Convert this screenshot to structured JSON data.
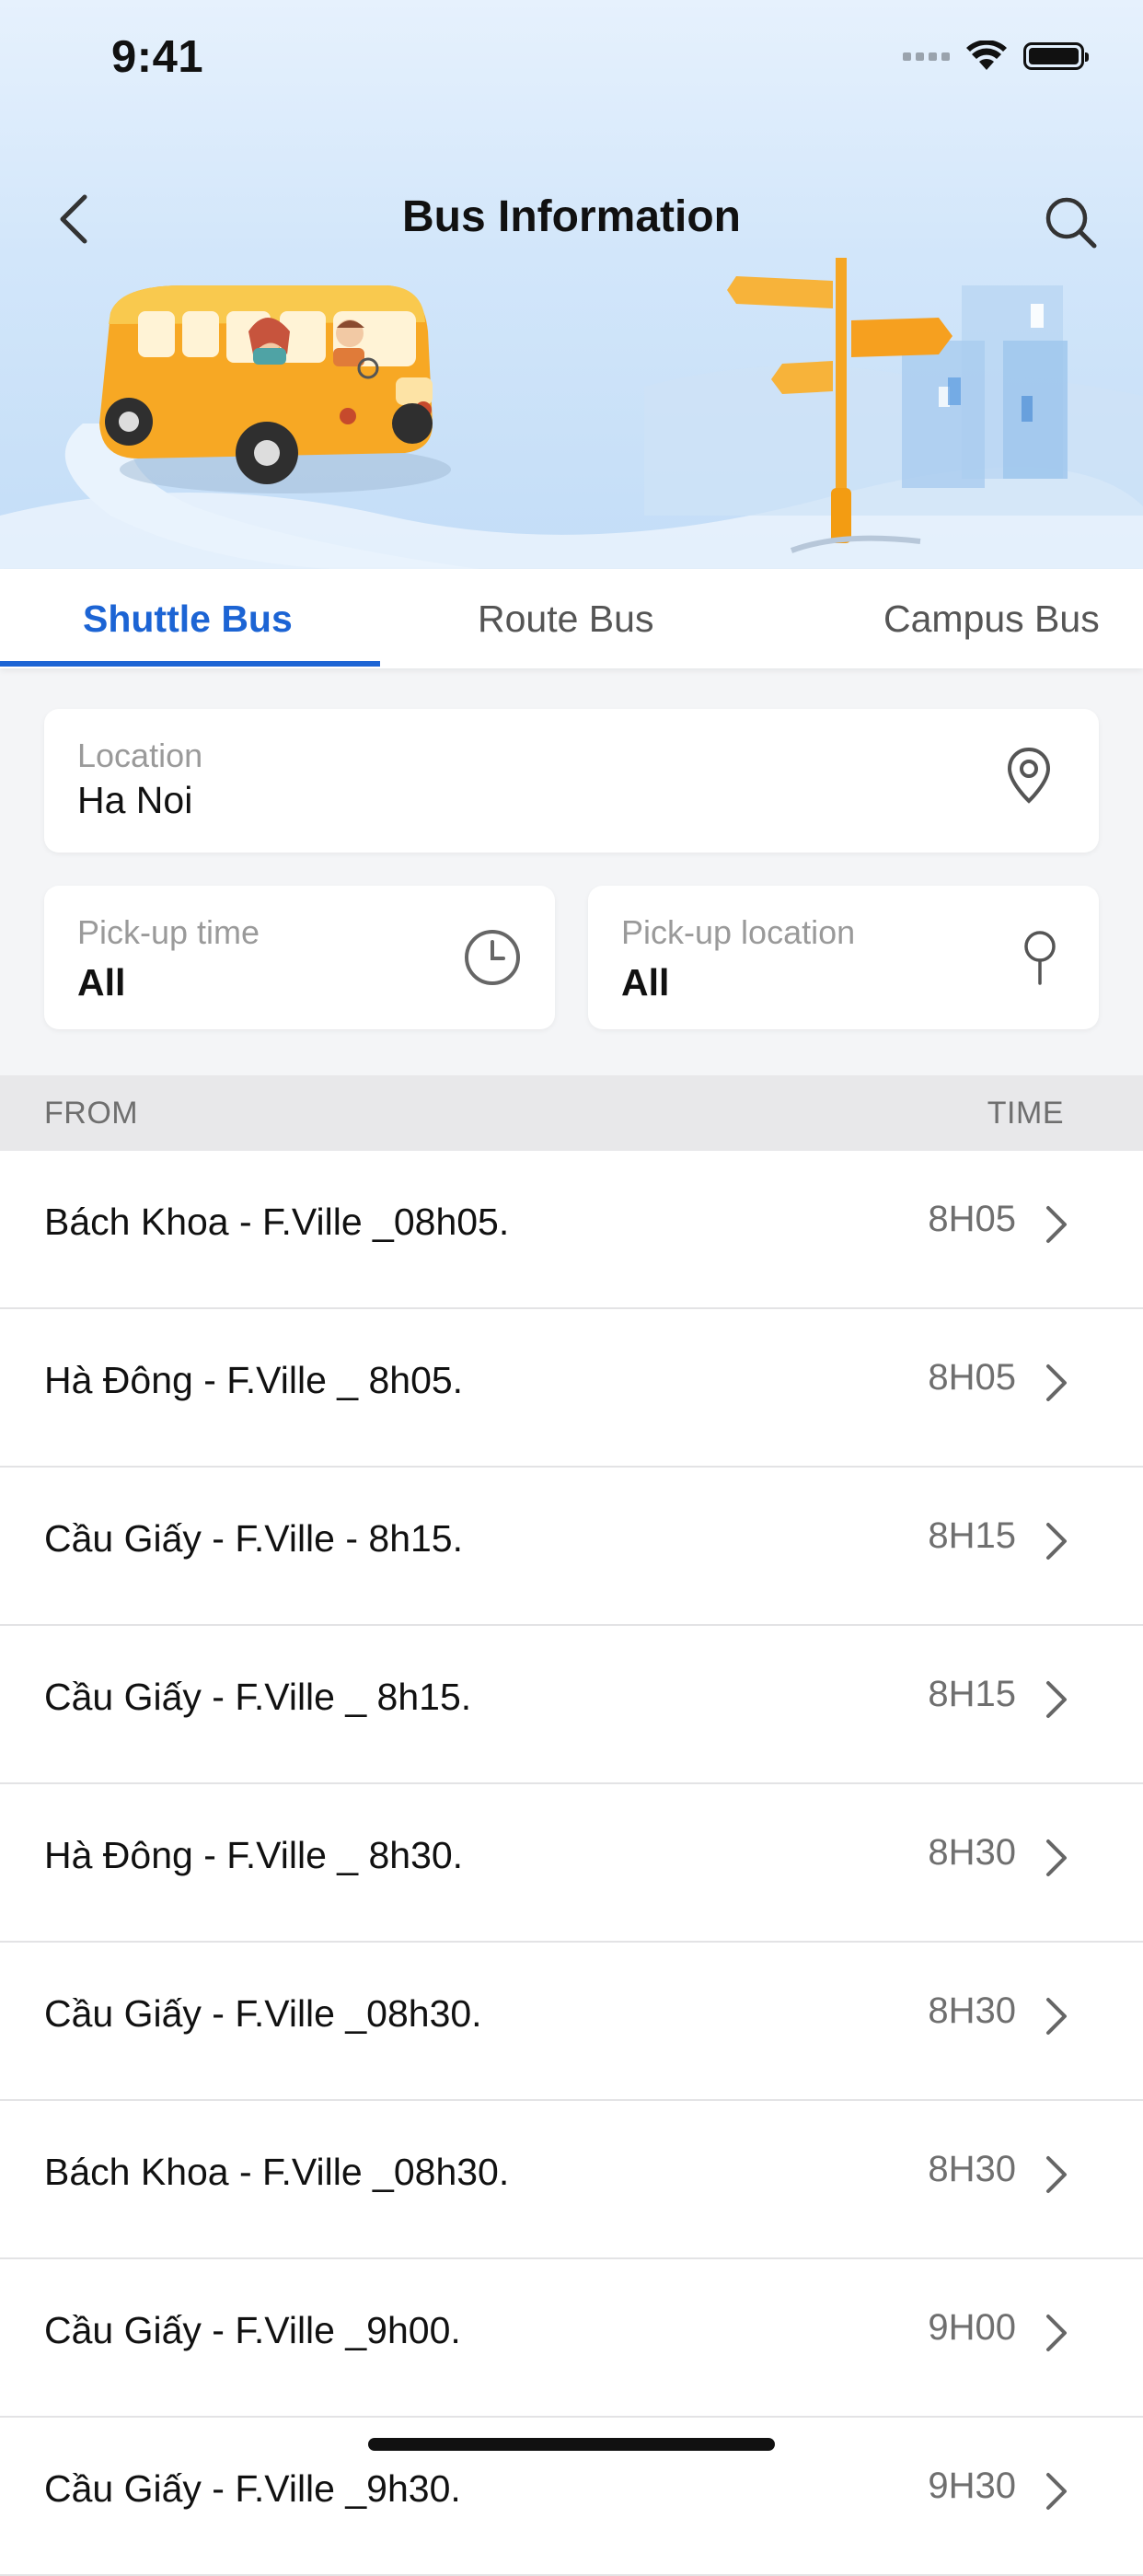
{
  "status_bar": {
    "time": "9:41"
  },
  "nav": {
    "title": "Bus Information",
    "back_icon": "chevron-left-icon",
    "search_icon": "search-icon"
  },
  "tabs": [
    {
      "label": "Shuttle Bus",
      "active": true
    },
    {
      "label": "Route Bus",
      "active": false
    },
    {
      "label": "Campus Bus",
      "active": false
    }
  ],
  "location": {
    "label": "Location",
    "value": "Ha Noi",
    "icon": "map-pin-icon"
  },
  "pickup_time": {
    "label": "Pick-up time",
    "value": "All",
    "icon": "clock-icon"
  },
  "pickup_location": {
    "label": "Pick-up location",
    "value": "All",
    "icon": "pin-icon"
  },
  "list_header": {
    "from": "FROM",
    "time": "TIME"
  },
  "routes": [
    {
      "name": "Bách Khoa - F.Ville _08h05.",
      "time": "8H05"
    },
    {
      "name": "Hà Đông - F.Ville _ 8h05.",
      "time": "8H05"
    },
    {
      "name": "Cầu Giấy - F.Ville - 8h15.",
      "time": "8H15"
    },
    {
      "name": "Cầu Giấy - F.Ville _ 8h15.",
      "time": "8H15"
    },
    {
      "name": "Hà Đông - F.Ville _ 8h30.",
      "time": "8H30"
    },
    {
      "name": "Cầu Giấy - F.Ville _08h30.",
      "time": "8H30"
    },
    {
      "name": "Bách Khoa - F.Ville _08h30.",
      "time": "8H30"
    },
    {
      "name": "Cầu Giấy - F.Ville _9h00.",
      "time": "9H00"
    },
    {
      "name": "Cầu Giấy - F.Ville _9h30.",
      "time": "9H30"
    }
  ],
  "colors": {
    "accent": "#1c64d4",
    "header_bg": "#d2e6fa",
    "divider": "#e3e3e5"
  }
}
